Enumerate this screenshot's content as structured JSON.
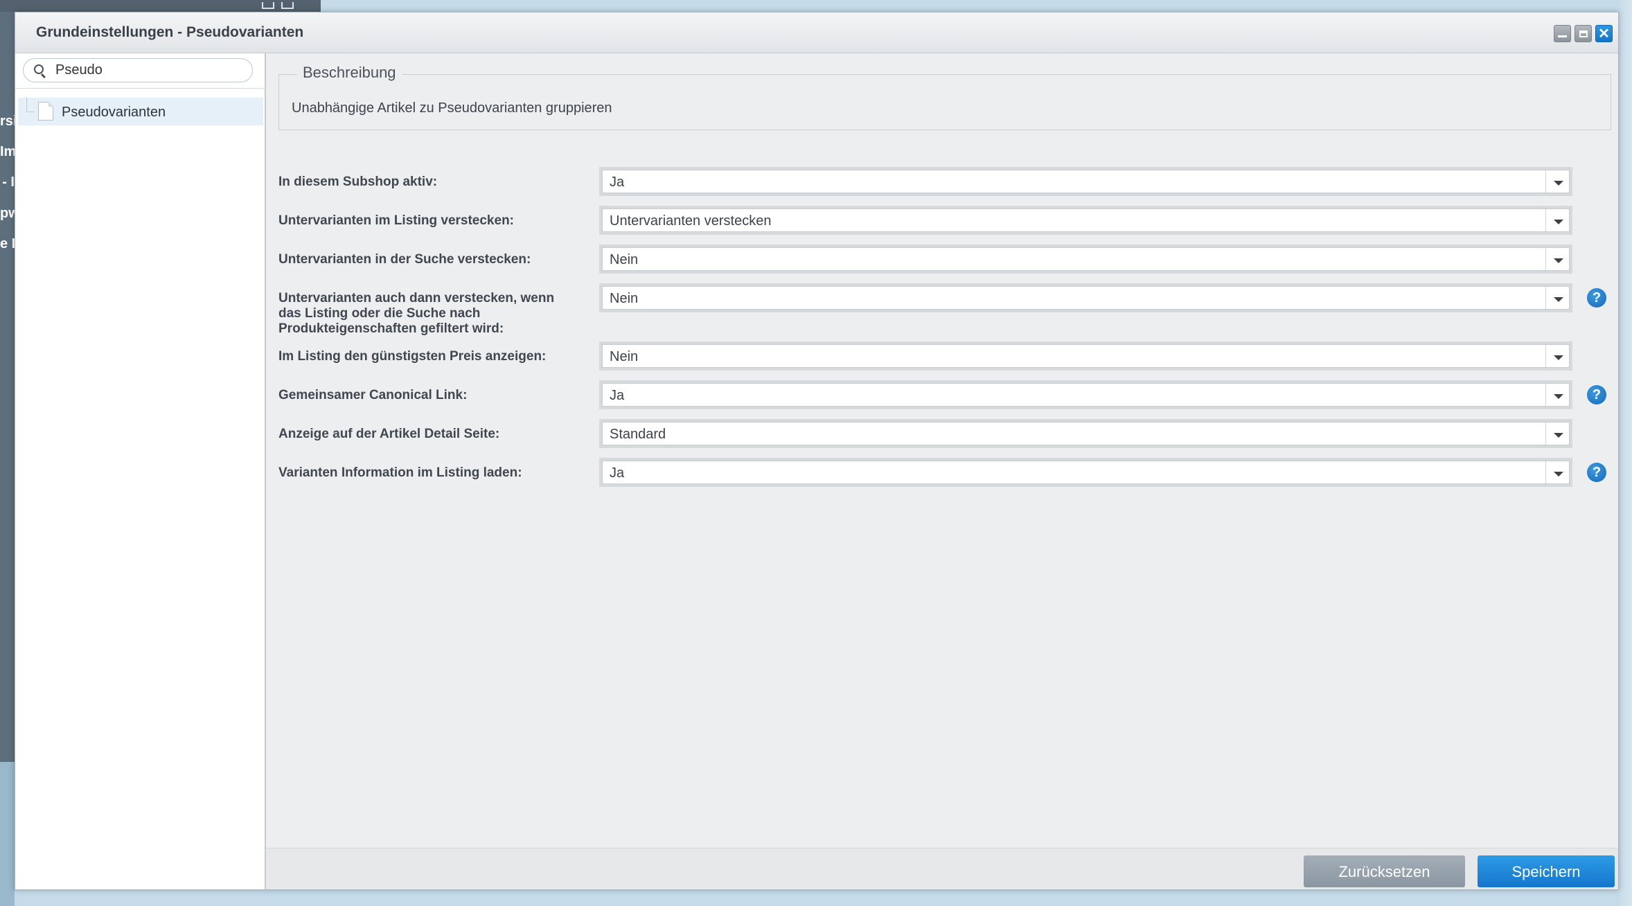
{
  "window": {
    "title": "Grundeinstellungen - Pseudovarianten"
  },
  "background": {
    "peek_texts": [
      "rsi",
      "Im",
      "- I",
      "pw",
      "e I"
    ]
  },
  "sidebar": {
    "search": {
      "value": "Pseudo",
      "placeholder": ""
    },
    "tree_items": [
      {
        "label": "Pseudovarianten",
        "selected": true
      }
    ]
  },
  "main": {
    "description": {
      "legend": "Beschreibung",
      "text": "Unabhängige Artikel zu Pseudovarianten gruppieren"
    },
    "fields": [
      {
        "label": "In diesem Subshop aktiv:",
        "value": "Ja",
        "help": false
      },
      {
        "label": "Untervarianten im Listing verstecken:",
        "value": "Untervarianten verstecken",
        "help": false
      },
      {
        "label": "Untervarianten in der Suche verstecken:",
        "value": "Nein",
        "help": false
      },
      {
        "label": "Untervarianten auch dann verstecken, wenn das Listing oder die Suche nach Produkteigenschaften gefiltert wird:",
        "value": "Nein",
        "help": true
      },
      {
        "label": "Im Listing den günstigsten Preis anzeigen:",
        "value": "Nein",
        "help": false
      },
      {
        "label": "Gemeinsamer Canonical Link:",
        "value": "Ja",
        "help": true
      },
      {
        "label": "Anzeige auf der Artikel Detail Seite:",
        "value": "Standard",
        "help": false
      },
      {
        "label": "Varianten Information im Listing laden:",
        "value": "Ja",
        "help": true
      }
    ],
    "help_glyph": "?"
  },
  "footer": {
    "reset_label": "Zurücksetzen",
    "save_label": "Speichern"
  },
  "colors": {
    "accent": "#1a7fd3",
    "reset_button": "#95a1ac",
    "panel_bg": "#edeef0"
  }
}
